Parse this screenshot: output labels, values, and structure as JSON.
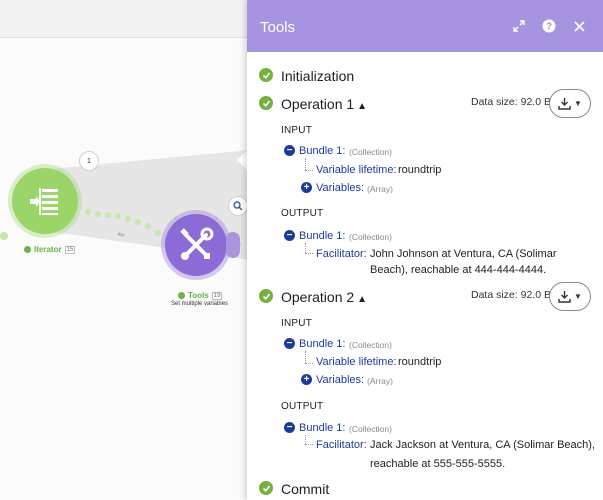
{
  "canvas": {
    "iterator": {
      "label": "Iterator",
      "badge": "15",
      "icon": "iterator-icon",
      "color": "#9bd56a"
    },
    "tools": {
      "label": "Tools",
      "badge": "19",
      "subtitle": "Set multiple variables",
      "icon": "wrench-screwdriver-icon",
      "color": "#8c6bd6"
    },
    "bundle_count": "1"
  },
  "panel": {
    "title": "Tools",
    "header_color": "#a794e0",
    "initialization": "Initialization",
    "commit": "Commit",
    "operations": [
      {
        "title": "Operation 1",
        "data_size": "Data size: 92.0 B",
        "input_label": "INPUT",
        "output_label": "OUTPUT",
        "input_bundle": "Bundle 1:",
        "input_bundle_type": "(Collection)",
        "var_lifetime_key": "Variable lifetime:",
        "var_lifetime_value": "roundtrip",
        "variables_key": "Variables:",
        "variables_type": "(Array)",
        "output_bundle": "Bundle 1:",
        "output_bundle_type": "(Collection)",
        "facilitator_key": "Facilitator:",
        "facilitator_line1": "John Johnson at Ventura, CA (Solimar",
        "facilitator_line2": "Beach), reachable at 444-444-4444."
      },
      {
        "title": "Operation 2",
        "data_size": "Data size: 92.0 B",
        "input_label": "INPUT",
        "output_label": "OUTPUT",
        "input_bundle": "Bundle 1:",
        "input_bundle_type": "(Collection)",
        "var_lifetime_key": "Variable lifetime:",
        "var_lifetime_value": "roundtrip",
        "variables_key": "Variables:",
        "variables_type": "(Array)",
        "output_bundle": "Bundle 1:",
        "output_bundle_type": "(Collection)",
        "facilitator_key": "Facilitator:",
        "facilitator_line1": "Jack Jackson at Ventura, CA (Solimar Beach),",
        "facilitator_line2": "reachable at 555-555-5555."
      }
    ]
  }
}
